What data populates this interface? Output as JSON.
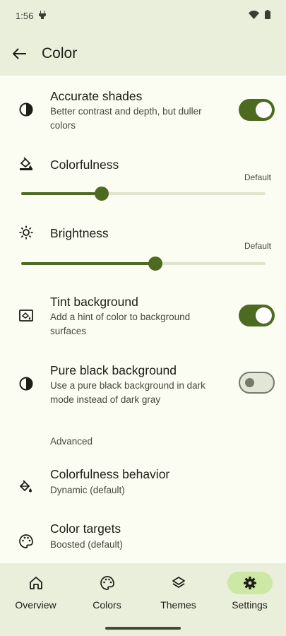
{
  "status_bar": {
    "time": "1:56"
  },
  "top_bar": {
    "title": "Color"
  },
  "settings": {
    "accurate_shades": {
      "title": "Accurate shades",
      "subtitle": "Better contrast and depth, but duller colors",
      "enabled": true
    },
    "colorfulness": {
      "title": "Colorfulness",
      "default_label": "Default",
      "value": 0.33
    },
    "brightness": {
      "title": "Brightness",
      "default_label": "Default",
      "value": 0.55
    },
    "tint_background": {
      "title": "Tint background",
      "subtitle": "Add a hint of color to background surfaces",
      "enabled": true
    },
    "pure_black": {
      "title": "Pure black background",
      "subtitle": "Use a pure black background in dark mode instead of dark gray",
      "enabled": false
    },
    "advanced_header": "Advanced",
    "colorfulness_behavior": {
      "title": "Colorfulness behavior",
      "subtitle": "Dynamic (default)"
    },
    "color_targets": {
      "title": "Color targets",
      "subtitle": "Boosted (default)"
    }
  },
  "bottom_nav": {
    "items": [
      {
        "label": "Overview",
        "icon": "home-icon"
      },
      {
        "label": "Colors",
        "icon": "palette-icon"
      },
      {
        "label": "Themes",
        "icon": "layers-icon"
      },
      {
        "label": "Settings",
        "icon": "gear-icon",
        "active": true
      }
    ]
  },
  "colors": {
    "accent": "#4c6a20",
    "surface": "#fbfdf2",
    "bar": "#eaefdc",
    "active_pill": "#cde8a4"
  }
}
